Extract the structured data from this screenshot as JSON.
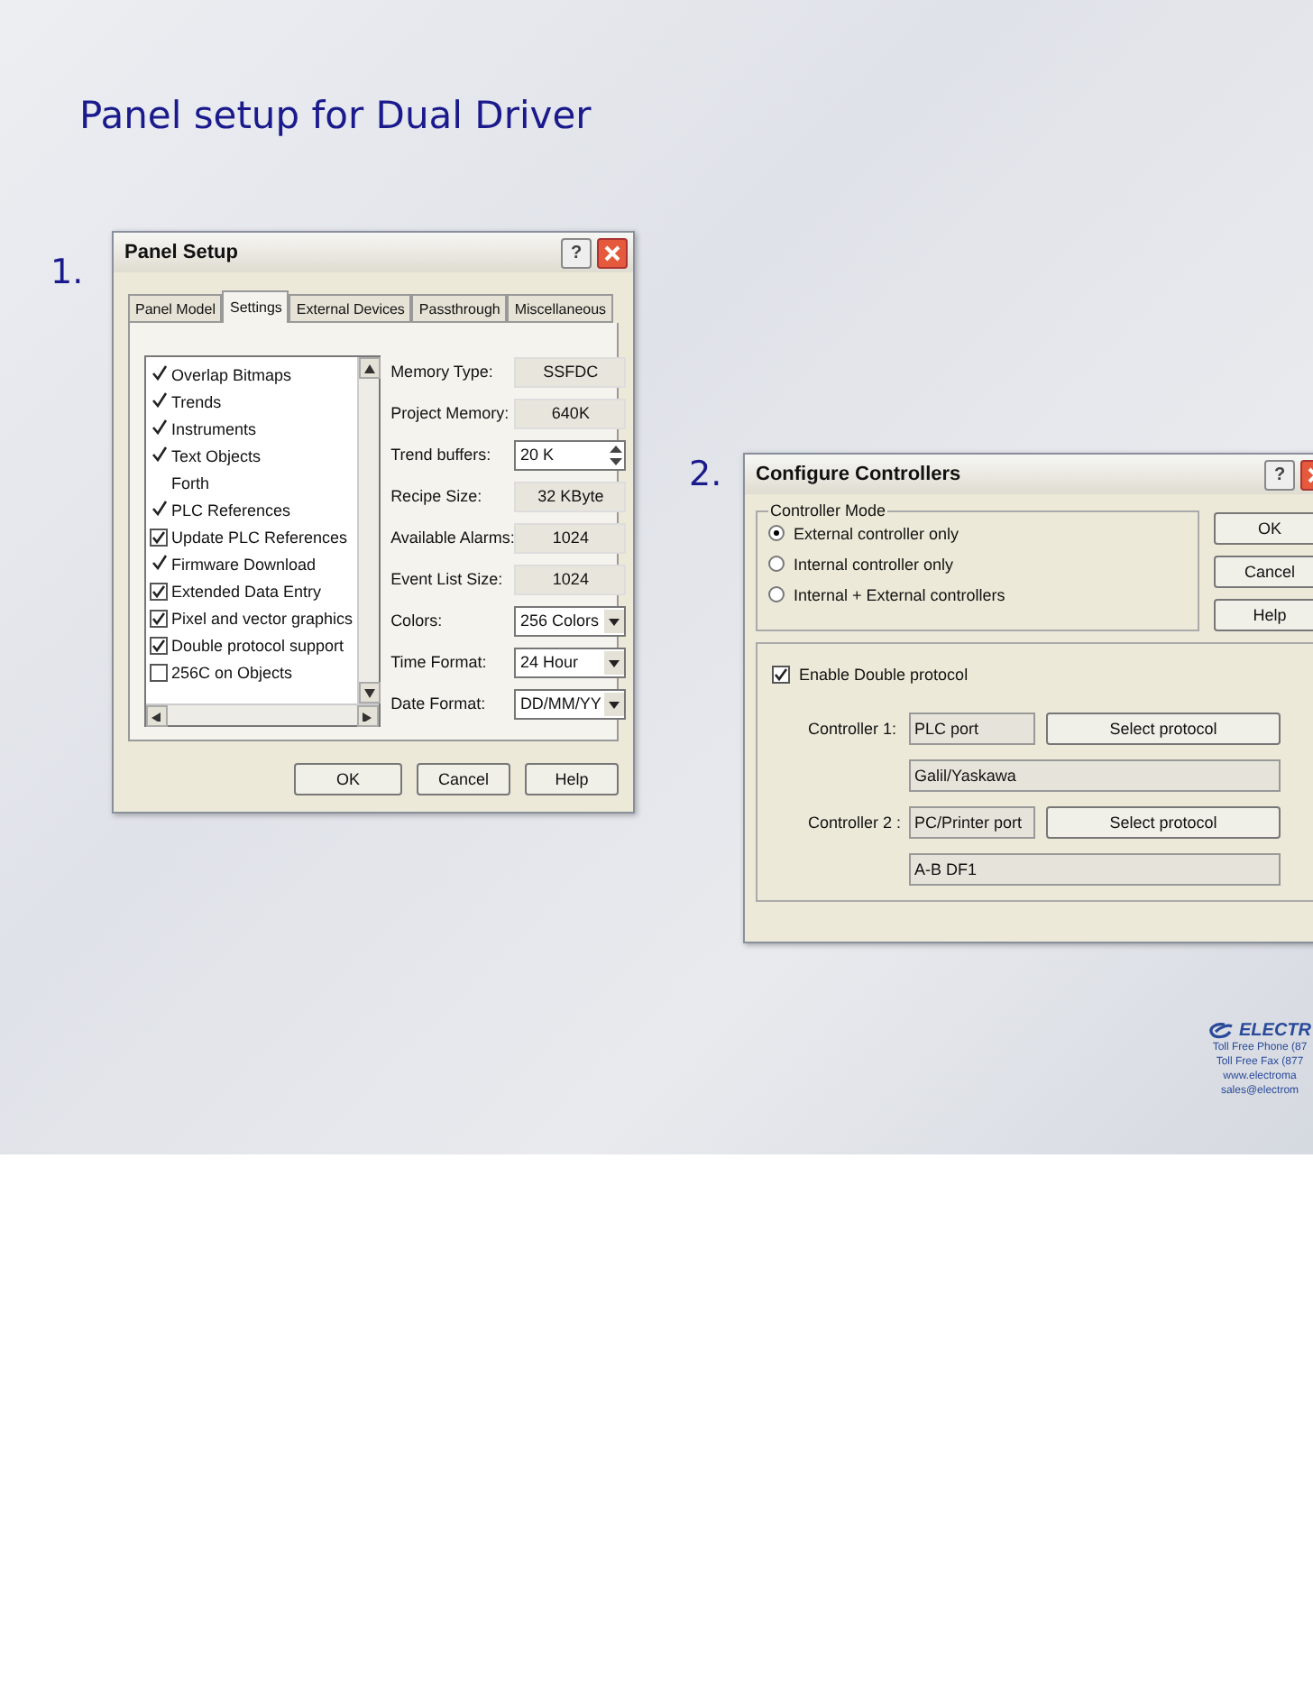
{
  "slide_title": "Panel setup for Dual Driver",
  "step_labels": [
    "1.",
    "2."
  ],
  "panel_setup": {
    "title": "Panel Setup",
    "help": "?",
    "tabs": [
      {
        "label": "Panel Model",
        "selected": false
      },
      {
        "label": "Settings",
        "selected": true
      },
      {
        "label": "External Devices",
        "selected": false
      },
      {
        "label": "Passthrough",
        "selected": false
      },
      {
        "label": "Miscellaneous",
        "selected": false
      }
    ],
    "features": [
      {
        "label": "Overlap Bitmaps",
        "kind": "tick",
        "checked": true
      },
      {
        "label": "Trends",
        "kind": "tick",
        "checked": true
      },
      {
        "label": "Instruments",
        "kind": "tick",
        "checked": true
      },
      {
        "label": "Text Objects",
        "kind": "tick",
        "checked": true
      },
      {
        "label": "Forth",
        "kind": "plain"
      },
      {
        "label": "PLC References",
        "kind": "tick",
        "checked": true
      },
      {
        "label": "Update PLC References",
        "kind": "checkbox",
        "checked": true
      },
      {
        "label": "Firmware Download",
        "kind": "tick",
        "checked": true
      },
      {
        "label": "Extended Data Entry",
        "kind": "checkbox",
        "checked": true
      },
      {
        "label": "Pixel and vector graphics",
        "kind": "checkbox",
        "checked": true
      },
      {
        "label": "Double  protocol support",
        "kind": "checkbox",
        "checked": true
      },
      {
        "label": "256C on Objects",
        "kind": "checkbox",
        "checked": false
      }
    ],
    "properties": [
      {
        "label": "Memory Type:",
        "value": "SSFDC",
        "kind": "readonly"
      },
      {
        "label": "Project Memory:",
        "value": "640K",
        "kind": "readonly"
      },
      {
        "label": "Trend buffers:",
        "value": "20 K",
        "kind": "spin"
      },
      {
        "label": "Recipe Size:",
        "value": "32 KByte",
        "kind": "readonly"
      },
      {
        "label": "Available Alarms:",
        "value": "1024",
        "kind": "readonly"
      },
      {
        "label": "Event List Size:",
        "value": "1024",
        "kind": "readonly"
      },
      {
        "label": "Colors:",
        "value": "256 Colors",
        "kind": "dropdown"
      },
      {
        "label": "Time Format:",
        "value": "24 Hour",
        "kind": "dropdown"
      },
      {
        "label": "Date Format:",
        "value": "DD/MM/YY",
        "kind": "dropdown"
      }
    ],
    "buttons": [
      "OK",
      "Cancel",
      "Help"
    ]
  },
  "configure_controllers": {
    "title": "Configure Controllers",
    "help": "?",
    "group_title": "Controller Mode",
    "modes": [
      {
        "label": "External controller only",
        "selected": true
      },
      {
        "label": "Internal controller only",
        "selected": false
      },
      {
        "label": "Internal + External controllers",
        "selected": false
      }
    ],
    "double_protocol": {
      "label": "Enable Double protocol",
      "checked": true
    },
    "controllers": [
      {
        "label": "Controller 1:",
        "port": "PLC port",
        "button": "Select protocol",
        "protocol": "Galil/Yaskawa"
      },
      {
        "label": "Controller 2 :",
        "port": "PC/Printer port",
        "button": "Select protocol",
        "protocol": "A-B DF1"
      }
    ],
    "buttons": [
      "OK",
      "Cancel",
      "Help"
    ]
  },
  "footer": {
    "brand": "ELECTR",
    "lines": [
      "Toll Free Phone  (87",
      "Toll Free Fax  (877",
      "www.electroma",
      "sales@electrom"
    ]
  }
}
